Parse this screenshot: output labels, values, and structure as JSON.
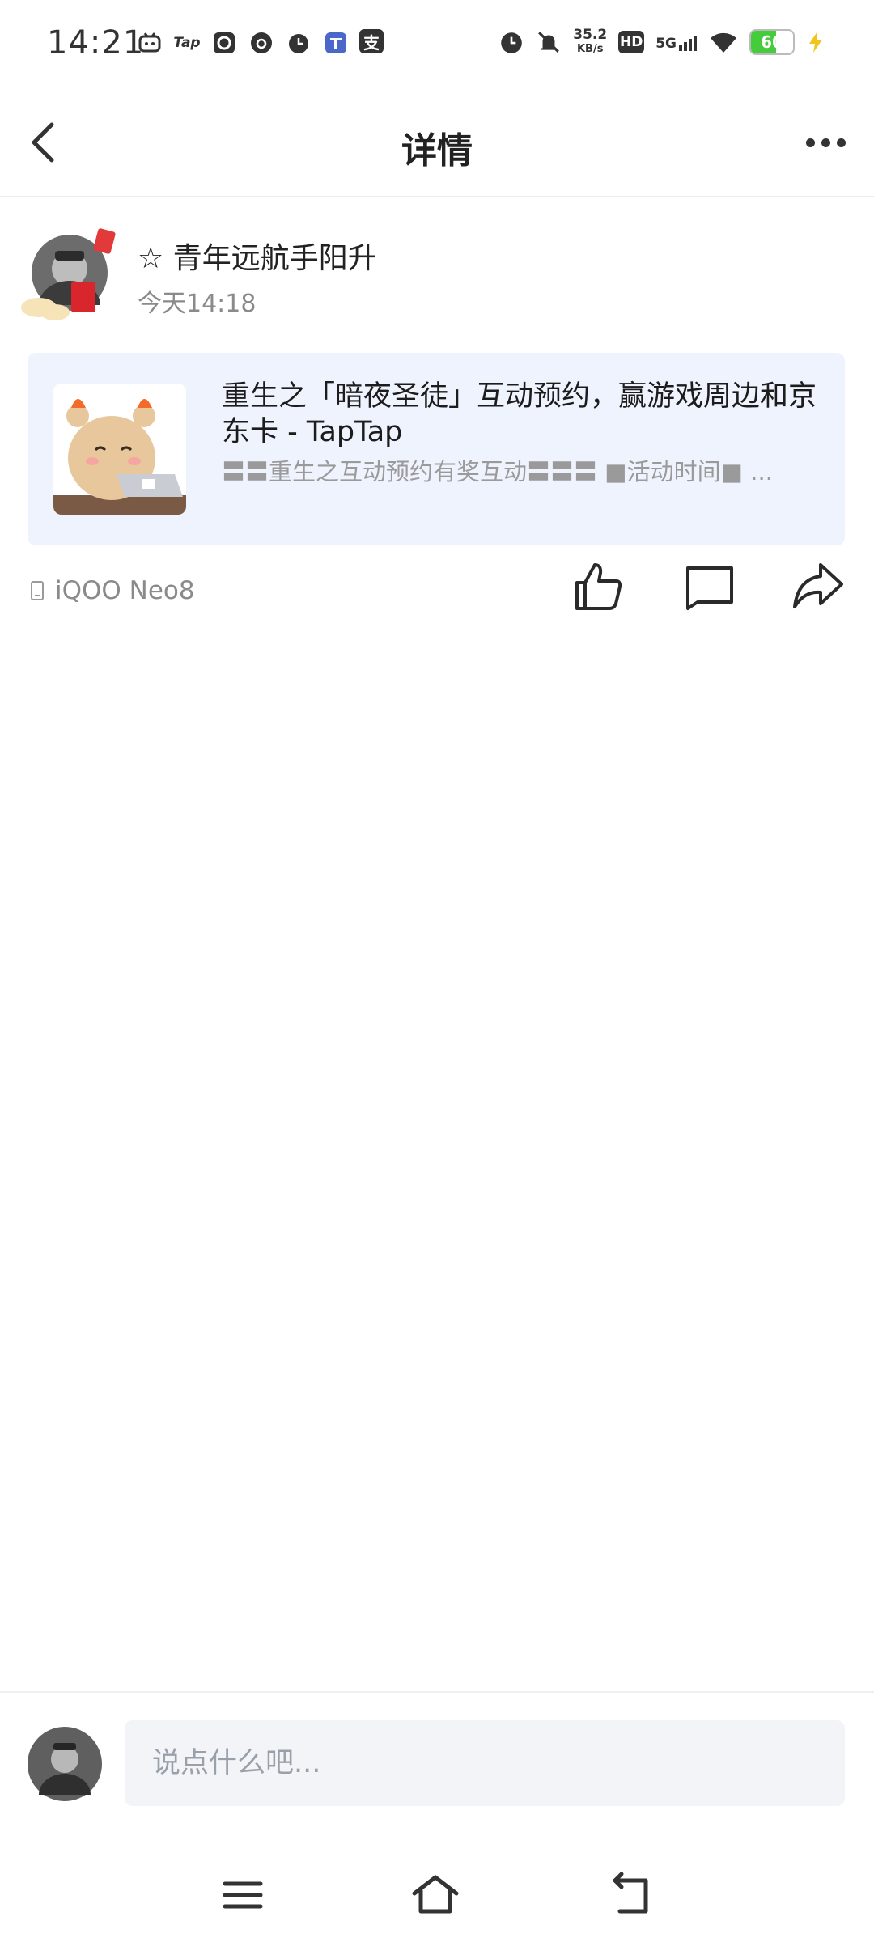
{
  "status_bar": {
    "time": "14:21",
    "notification_icons": [
      "bilibili-icon",
      "taptap-icon",
      "browser-icon",
      "music-icon",
      "clock-icon",
      "work-app-icon",
      "alipay-icon"
    ],
    "taptap_text": "Tap",
    "alipay_text": "支",
    "net_speed_value": "35.2",
    "net_speed_unit": "KB/s",
    "hd_label": "HD",
    "network_label": "5G",
    "battery_level": 60,
    "battery_text": "60",
    "battery_color": "#45cc3a"
  },
  "navbar": {
    "title": "详情"
  },
  "post": {
    "author": "☆ 青年远航手阳升",
    "time": "今天14:18",
    "device": "iQOO Neo8",
    "link_card": {
      "title": "重生之「暗夜圣徒」互动预约，赢游戏周边和京东卡 - TapTap",
      "description": "〓〓重生之互动预约有奖互动〓〓〓 ■活动时间■ ..."
    }
  },
  "comment_bar": {
    "placeholder": "说点什么吧..."
  },
  "colors": {
    "card_background": "#eef3fd",
    "muted_text": "#8a8a8a"
  }
}
